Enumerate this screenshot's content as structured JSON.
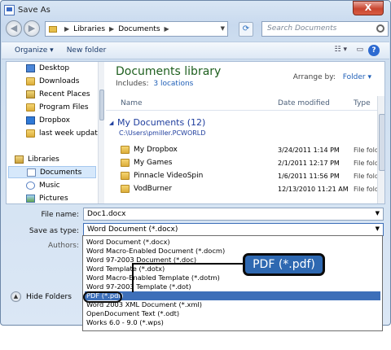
{
  "window": {
    "title": "Save As",
    "close_label": "X"
  },
  "address": {
    "segments": [
      "Libraries",
      "Documents"
    ],
    "search_placeholder": "Search Documents"
  },
  "toolbar": {
    "organize": "Organize ▾",
    "new_folder": "New folder",
    "view_icon": "views-icon",
    "help": "?"
  },
  "nav": {
    "items": [
      {
        "label": "Desktop",
        "icon": "desktop-icon"
      },
      {
        "label": "Downloads",
        "icon": "folder-icon"
      },
      {
        "label": "Recent Places",
        "icon": "recent-places-icon"
      },
      {
        "label": "Program Files",
        "icon": "folder-icon"
      },
      {
        "label": "Dropbox",
        "icon": "dropbox-icon"
      },
      {
        "label": "last week update",
        "icon": "folder-icon"
      },
      {
        "label": "Libraries",
        "icon": "libraries-icon"
      },
      {
        "label": "Documents",
        "icon": "documents-icon"
      },
      {
        "label": "Music",
        "icon": "music-icon"
      },
      {
        "label": "Pictures",
        "icon": "pictures-icon"
      }
    ]
  },
  "library": {
    "title": "Documents library",
    "includes_label": "Includes:",
    "includes_link": "3 locations",
    "arrange_label": "Arrange by:",
    "arrange_value": "Folder ▾",
    "columns": {
      "name": "Name",
      "date": "Date modified",
      "type": "Type"
    },
    "group_title": "My Documents (12)",
    "group_path": "C:\\Users\\pmiller.PCWORLD",
    "rows": [
      {
        "name": "My Dropbox",
        "date": "3/24/2011 1:14 PM",
        "type": "File fold"
      },
      {
        "name": "My Games",
        "date": "2/1/2011 12:17 PM",
        "type": "File fold"
      },
      {
        "name": "Pinnacle VideoSpin",
        "date": "1/6/2011 11:56 PM",
        "type": "File fold"
      },
      {
        "name": "VodBurner",
        "date": "12/13/2010 11:21 AM",
        "type": "File fold"
      }
    ]
  },
  "form": {
    "file_name_label": "File name:",
    "file_name_value": "Doc1.docx",
    "save_as_type_label": "Save as type:",
    "save_as_type_value": "Word Document (*.docx)",
    "authors_label": "Authors:",
    "hide_folders": "Hide Folders"
  },
  "type_options": [
    "Word Document (*.docx)",
    "Word Macro-Enabled Document (*.docm)",
    "Word 97-2003 Document (*.doc)",
    "Word Template (*.dotx)",
    "Word Macro-Enabled Template (*.dotm)",
    "Word 97-2003 Template (*.dot)",
    "PDF (*.pdf)",
    "Word 2003 XML Document (*.xml)",
    "OpenDocument Text (*.odt)",
    "Works 6.0 - 9.0 (*.wps)"
  ],
  "selected_option_index": 6,
  "callout": {
    "text": "PDF (*.pdf)"
  },
  "colors": {
    "accent": "#3d6fb9",
    "library_title": "#1e5f1e",
    "callout_bg": "#2e68b1"
  }
}
